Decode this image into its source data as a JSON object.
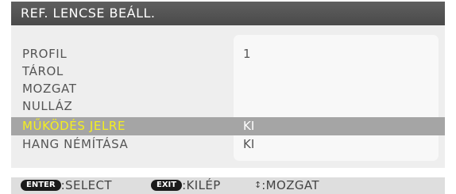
{
  "window": {
    "title": "REF. LENCSE BEÁLL."
  },
  "menu": {
    "rows": [
      {
        "label": "PROFIL",
        "value": "1"
      },
      {
        "label": "TÁROL",
        "value": ""
      },
      {
        "label": "MOZGAT",
        "value": ""
      },
      {
        "label": "NULLÁZ",
        "value": ""
      },
      {
        "label": "MŰKÖDÉS JELRE",
        "value": "KI"
      },
      {
        "label": "HANG NÉMÍTÁSA",
        "value": "KI"
      }
    ],
    "selected_row": "MŰKÖDÉS JELRE"
  },
  "footer": {
    "enter_key": "ENTER",
    "enter_text": ":SELECT",
    "exit_key": "EXIT",
    "exit_text": ":KILÉP",
    "move_icon": "updown-arrows-icon",
    "move_text": ":MOZGAT"
  },
  "colors": {
    "title_bar": "#555555",
    "panel": "#eeeeee",
    "selected_row": "#a5a5a5",
    "selected_label": "#f4ef1e"
  }
}
